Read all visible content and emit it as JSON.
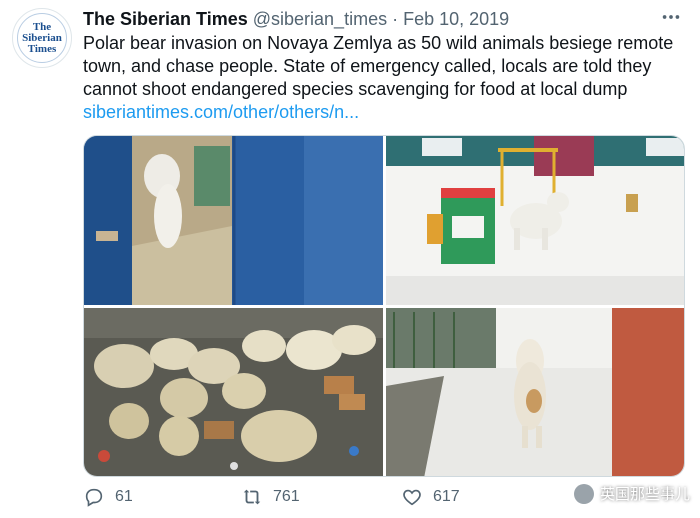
{
  "account": {
    "avatar_text": "The\nSiberian\nTimes",
    "display_name": "The Siberian Times",
    "handle": "@siberian_times",
    "separator": "·",
    "date": "Feb 10, 2019"
  },
  "tweet": {
    "text": "Polar bear invasion on Novaya Zemlya as 50 wild animals besiege remote town, and chase people. State of emergency called, locals are told they cannot shoot endangered species scavenging for food at local dump",
    "link": "siberiantimes.com/other/others/n..."
  },
  "actions": {
    "replies": "61",
    "retweets": "761",
    "likes": "617"
  },
  "watermark": {
    "text": "英国那些事儿"
  },
  "colors": {
    "link": "#1d9bf0",
    "muted": "#536471"
  }
}
